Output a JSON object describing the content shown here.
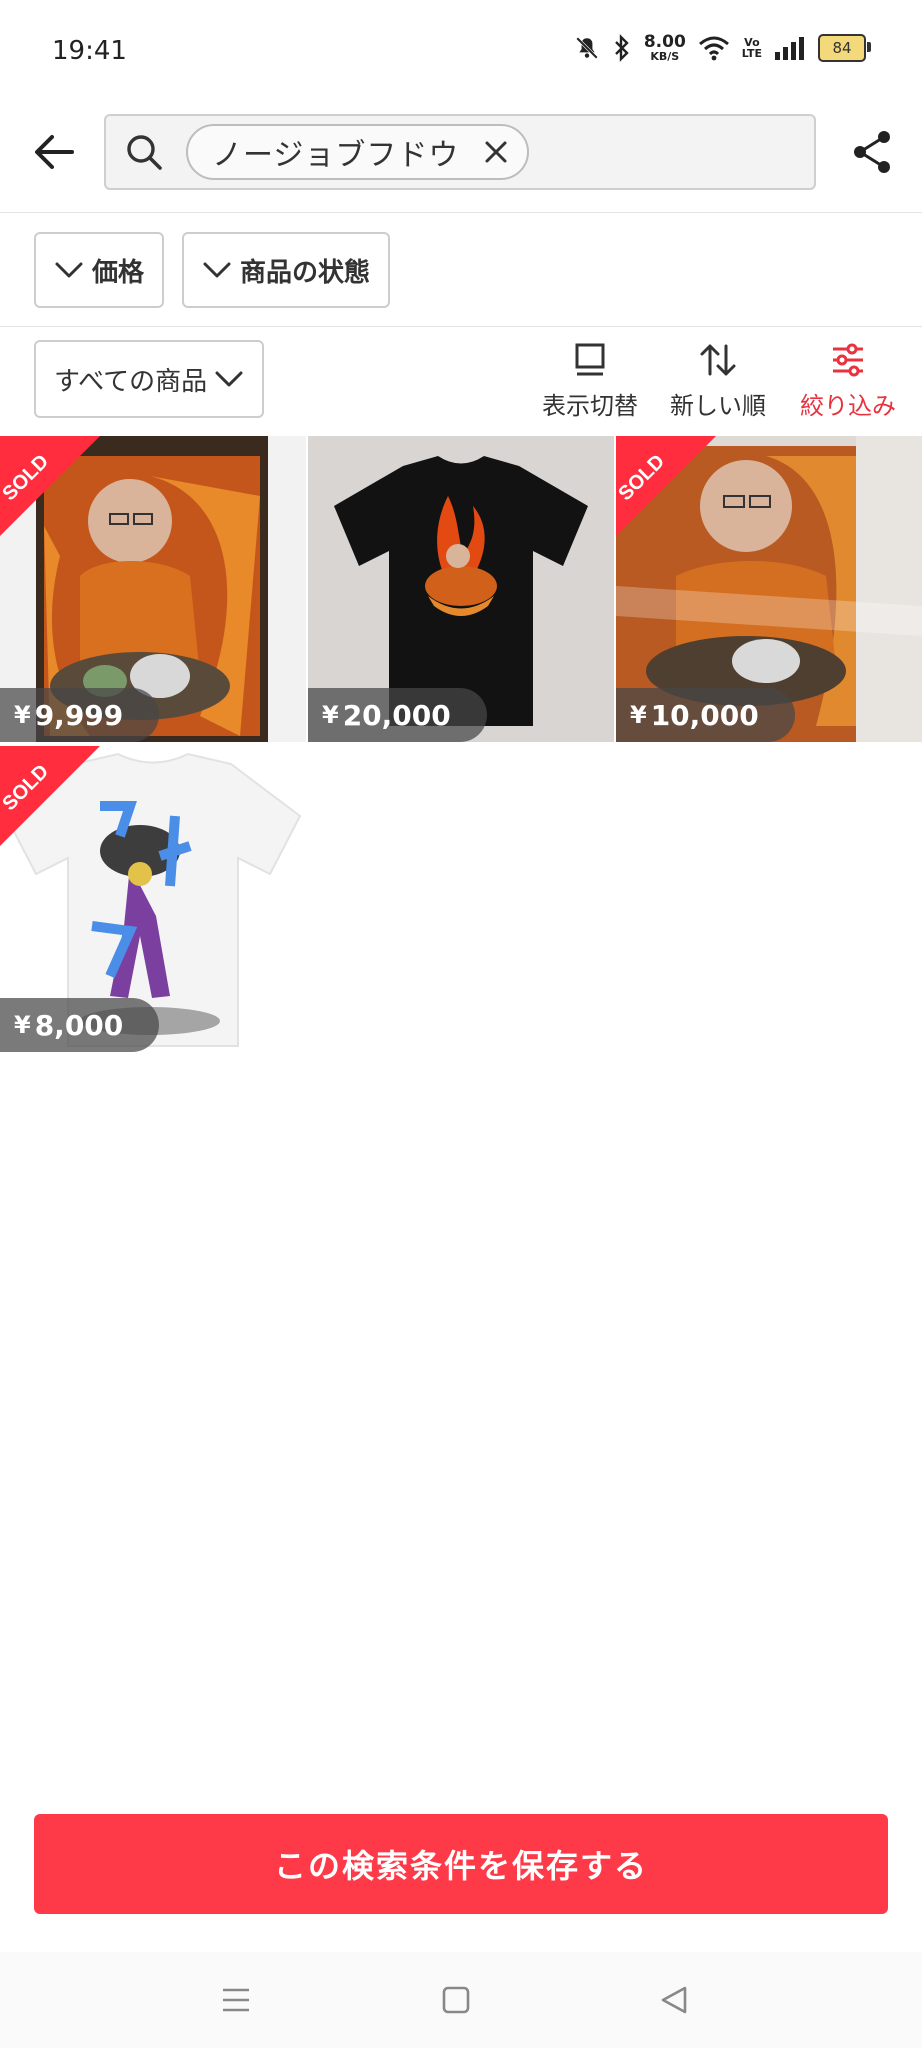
{
  "status": {
    "time": "19:41",
    "net_speed": "8.00",
    "net_unit": "KB/S",
    "volte_top": "Vo",
    "volte_bottom": "LTE",
    "battery": "84"
  },
  "search": {
    "chip_text": "ノージョブフドウ"
  },
  "filters": [
    {
      "label": "価格"
    },
    {
      "label": "商品の状態"
    }
  ],
  "sort_bar": {
    "all_items": "すべての商品",
    "view_toggle": "表示切替",
    "sort_newest": "新しい順",
    "refine": "絞り込み"
  },
  "items": [
    {
      "price": "9,999",
      "sold": true,
      "sold_label": "SOLD"
    },
    {
      "price": "20,000",
      "sold": false
    },
    {
      "price": "10,000",
      "sold": true,
      "sold_label": "SOLD"
    },
    {
      "price": "8,000",
      "sold": true,
      "sold_label": "SOLD"
    }
  ],
  "currency": "¥",
  "save_button": "この検索条件を保存する",
  "colors": {
    "accent": "#ff3a48",
    "refine": "#e8333f"
  },
  "icons": [
    "back-arrow-icon",
    "search-icon",
    "close-icon",
    "share-icon",
    "chevron-down-icon",
    "view-toggle-icon",
    "sort-icon",
    "filter-sliders-icon",
    "menu-icon",
    "home-icon",
    "back-triangle-icon"
  ]
}
